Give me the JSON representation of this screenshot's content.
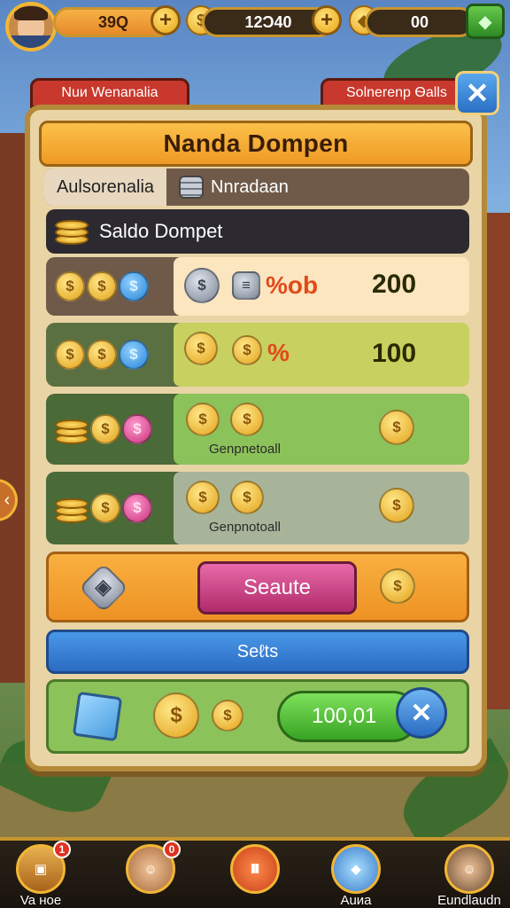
{
  "hud": {
    "player_coins": "39Q",
    "gold_amount": "12Ɔ40",
    "gems_amount": "00"
  },
  "tabs": {
    "left_label": "Nuи Wenanalia",
    "right_label": "Solnerenp Ѳalls"
  },
  "panel": {
    "title": "Nanda Dompen",
    "subtab_a": "Aulsorenalia",
    "subtab_b": "Nnradaan",
    "saldo_label": "Saldo Dompet"
  },
  "rows": [
    {
      "id": "row1",
      "pct_label": "%ob",
      "value": "200"
    },
    {
      "id": "row2",
      "pct_label": "%",
      "value": "100"
    },
    {
      "id": "row3",
      "caption": "Genpnetoall"
    },
    {
      "id": "row4",
      "caption": "Genpnotoall"
    }
  ],
  "actions": {
    "seaute_button": "Seaute",
    "blue_bar": "Seℓts",
    "green_value": "100,01"
  },
  "bottom_nav": [
    {
      "label": "Va ʜoe",
      "badge": "1"
    },
    {
      "label": "",
      "badge": "0"
    },
    {
      "label": "",
      "badge": ""
    },
    {
      "label": "Auиa",
      "badge": ""
    },
    {
      "label": "Eundlaudn",
      "badge": ""
    }
  ],
  "colors": {
    "panel_bg": "#e9d4a6",
    "title_orange": "#ef9a24",
    "accent_gold": "#f2b634",
    "row_peach": "#fbe6c0",
    "row_olive": "#c8d060",
    "row_green": "#8cc25a",
    "row_gray": "#a8b49a",
    "seaute_pink": "#c8327a",
    "blue_bar": "#2a6cc2",
    "green_pill": "#38a424"
  }
}
